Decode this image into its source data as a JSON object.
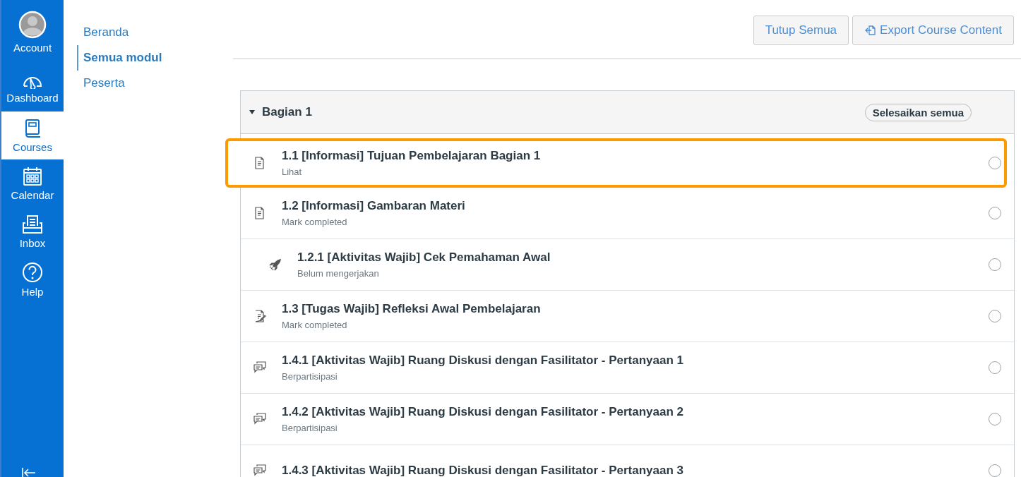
{
  "global_nav": [
    {
      "kind": "account",
      "label": "Account",
      "selected": false
    },
    {
      "kind": "dashboard",
      "label": "Dashboard",
      "selected": false
    },
    {
      "kind": "courses",
      "label": "Courses",
      "selected": true
    },
    {
      "kind": "calendar",
      "label": "Calendar",
      "selected": false
    },
    {
      "kind": "inbox",
      "label": "Inbox",
      "selected": false
    },
    {
      "kind": "help",
      "label": "Help",
      "selected": false
    }
  ],
  "course_nav": [
    {
      "label": "Beranda",
      "selected": false
    },
    {
      "label": "Semua modul",
      "selected": true
    },
    {
      "label": "Peserta",
      "selected": false
    }
  ],
  "toolbar": {
    "buttons": [
      {
        "kind": "plain",
        "label": "Tutup Semua"
      },
      {
        "kind": "export",
        "label": "Export Course Content"
      }
    ]
  },
  "module": {
    "title": "Bagian 1",
    "expanded": true,
    "complete_all": "Selesaikan semua",
    "items": [
      {
        "kind": "page",
        "title": "1.1 [Informasi] Tujuan Pembelajaran Bagian 1",
        "status": "Lihat",
        "highlighted": true,
        "completed": false
      },
      {
        "kind": "page",
        "title": "1.2 [Informasi] Gambaran Materi",
        "status": "Mark completed",
        "highlighted": false,
        "completed": false,
        "children": [
          {
            "kind": "quiz",
            "title": "1.2.1 [Aktivitas Wajib] Cek Pemahaman Awal",
            "status": "Belum mengerjakan",
            "highlighted": false,
            "completed": false
          }
        ]
      },
      {
        "kind": "assignment",
        "title": "1.3 [Tugas Wajib] Refleksi Awal Pembelajaran",
        "status": "Mark completed",
        "highlighted": false,
        "completed": false
      },
      {
        "kind": "discussion",
        "title": "1.4.1 [Aktivitas Wajib] Ruang Diskusi dengan Fasilitator - Pertanyaan 1",
        "status": "Berpartisipasi",
        "highlighted": false,
        "completed": false
      },
      {
        "kind": "discussion",
        "title": "1.4.2 [Aktivitas Wajib] Ruang Diskusi dengan Fasilitator - Pertanyaan 2",
        "status": "Berpartisipasi",
        "highlighted": false,
        "completed": false
      },
      {
        "kind": "discussion",
        "title": "1.4.3 [Aktivitas Wajib] Ruang Diskusi dengan Fasilitator - Pertanyaan 3",
        "highlighted": false,
        "completed": false
      }
    ]
  }
}
